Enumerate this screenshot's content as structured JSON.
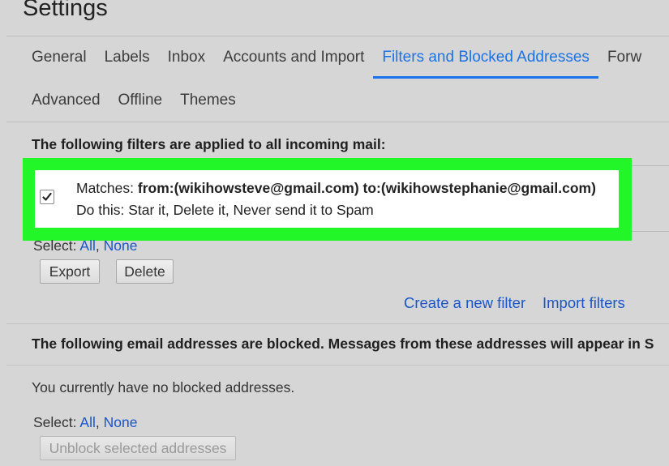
{
  "page": {
    "title": "Settings"
  },
  "tabs": {
    "row1": [
      {
        "label": "General"
      },
      {
        "label": "Labels"
      },
      {
        "label": "Inbox"
      },
      {
        "label": "Accounts and Import"
      },
      {
        "label": "Filters and Blocked Addresses",
        "active": true
      },
      {
        "label": "Forw"
      }
    ],
    "row2": [
      {
        "label": "Advanced"
      },
      {
        "label": "Offline"
      },
      {
        "label": "Themes"
      }
    ]
  },
  "filters": {
    "heading": "The following filters are applied to all incoming mail:",
    "items": [
      {
        "checked": true,
        "matches_label": "Matches: ",
        "criteria": "from:(wikihowsteve@gmail.com) to:(wikihowstephanie@gmail.com)",
        "action": "Do this: Star it, Delete it, Never send it to Spam"
      }
    ],
    "select": {
      "label": "Select: ",
      "all": "All",
      "separator": ", ",
      "none": "None"
    },
    "export_label": "Export",
    "delete_label": "Delete",
    "create_link": "Create a new filter",
    "import_link": "Import filters"
  },
  "blocked": {
    "heading": "The following email addresses are blocked. Messages from these addresses will appear in S",
    "empty_text": "You currently have no blocked addresses.",
    "select": {
      "label": "Select: ",
      "all": "All",
      "separator": ", ",
      "none": "None"
    },
    "unblock_label": "Unblock selected addresses"
  },
  "icons": {
    "checkbox": "checkmark-icon"
  },
  "colors": {
    "accent": "#1a73e8",
    "highlight": "#22f528",
    "link": "#1a56c9"
  }
}
